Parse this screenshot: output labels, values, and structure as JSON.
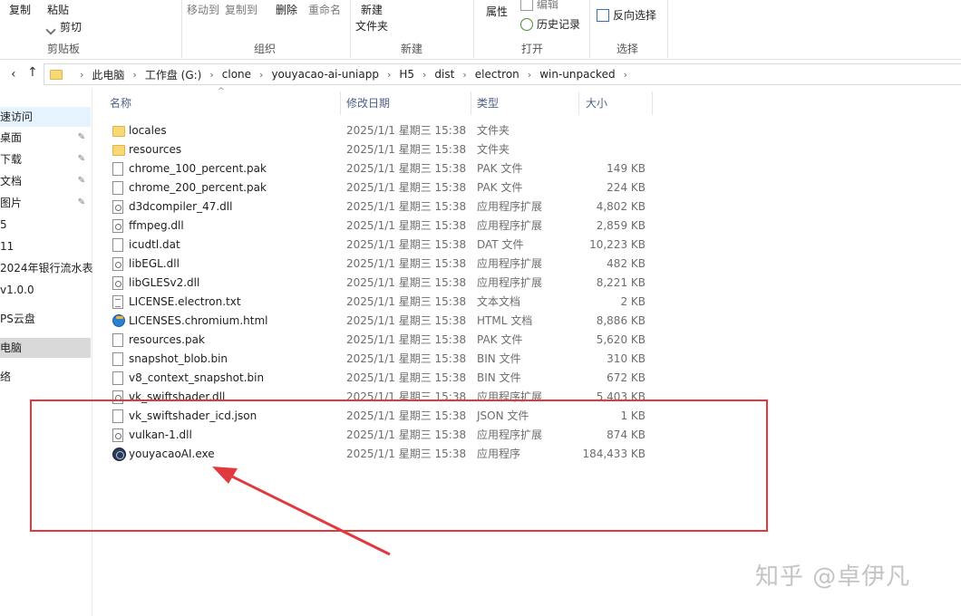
{
  "ribbon": {
    "copy": "复制",
    "paste": "粘贴",
    "cut": "剪切",
    "move_to": "移动到",
    "copy_to": "复制到",
    "delete": "删除",
    "rename": "重命名",
    "new_folder_line1": "新建",
    "new_folder_line2": "文件夹",
    "properties": "属性",
    "edit": "编辑",
    "history": "历史记录",
    "invert_selection": "反向选择",
    "groups": {
      "clipboard": "剪贴板",
      "organize": "组织",
      "new": "新建",
      "open": "打开",
      "select": "选择"
    }
  },
  "address": {
    "crumbs": [
      "此电脑",
      "工作盘 (G:)",
      "clone",
      "youyacao-ai-uniapp",
      "H5",
      "dist",
      "electron",
      "win-unpacked"
    ]
  },
  "sidebar": {
    "items": [
      {
        "label": "速访问"
      },
      {
        "label": "桌面"
      },
      {
        "label": "下载"
      },
      {
        "label": "文档"
      },
      {
        "label": "图片"
      },
      {
        "label": "5"
      },
      {
        "label": "11"
      },
      {
        "label": "2024年银行流水表"
      },
      {
        "label": "v1.0.0"
      },
      {
        "label": "PS云盘"
      },
      {
        "label": "电脑"
      },
      {
        "label": "络"
      }
    ]
  },
  "columns": {
    "name": "名称",
    "date": "修改日期",
    "type": "类型",
    "size": "大小"
  },
  "files": [
    {
      "name": "locales",
      "date": "2025/1/1 星期三 15:38",
      "type": "文件夹",
      "size": "",
      "icon": "folder-icon"
    },
    {
      "name": "resources",
      "date": "2025/1/1 星期三 15:38",
      "type": "文件夹",
      "size": "",
      "icon": "folder-icon"
    },
    {
      "name": "chrome_100_percent.pak",
      "date": "2025/1/1 星期三 15:38",
      "type": "PAK 文件",
      "size": "149 KB",
      "icon": "file-icon"
    },
    {
      "name": "chrome_200_percent.pak",
      "date": "2025/1/1 星期三 15:38",
      "type": "PAK 文件",
      "size": "224 KB",
      "icon": "file-icon"
    },
    {
      "name": "d3dcompiler_47.dll",
      "date": "2025/1/1 星期三 15:38",
      "type": "应用程序扩展",
      "size": "4,802 KB",
      "icon": "dll-icon"
    },
    {
      "name": "ffmpeg.dll",
      "date": "2025/1/1 星期三 15:38",
      "type": "应用程序扩展",
      "size": "2,859 KB",
      "icon": "dll-icon"
    },
    {
      "name": "icudtl.dat",
      "date": "2025/1/1 星期三 15:38",
      "type": "DAT 文件",
      "size": "10,223 KB",
      "icon": "file-icon"
    },
    {
      "name": "libEGL.dll",
      "date": "2025/1/1 星期三 15:38",
      "type": "应用程序扩展",
      "size": "482 KB",
      "icon": "dll-icon"
    },
    {
      "name": "libGLESv2.dll",
      "date": "2025/1/1 星期三 15:38",
      "type": "应用程序扩展",
      "size": "8,221 KB",
      "icon": "dll-icon"
    },
    {
      "name": "LICENSE.electron.txt",
      "date": "2025/1/1 星期三 15:38",
      "type": "文本文档",
      "size": "2 KB",
      "icon": "text-file-icon"
    },
    {
      "name": "LICENSES.chromium.html",
      "date": "2025/1/1 星期三 15:38",
      "type": "HTML 文档",
      "size": "8,886 KB",
      "icon": "html-file-icon"
    },
    {
      "name": "resources.pak",
      "date": "2025/1/1 星期三 15:38",
      "type": "PAK 文件",
      "size": "5,620 KB",
      "icon": "file-icon"
    },
    {
      "name": "snapshot_blob.bin",
      "date": "2025/1/1 星期三 15:38",
      "type": "BIN 文件",
      "size": "310 KB",
      "icon": "file-icon"
    },
    {
      "name": "v8_context_snapshot.bin",
      "date": "2025/1/1 星期三 15:38",
      "type": "BIN 文件",
      "size": "672 KB",
      "icon": "file-icon"
    },
    {
      "name": "vk_swiftshader.dll",
      "date": "2025/1/1 星期三 15:38",
      "type": "应用程序扩展",
      "size": "5,403 KB",
      "icon": "dll-icon"
    },
    {
      "name": "vk_swiftshader_icd.json",
      "date": "2025/1/1 星期三 15:38",
      "type": "JSON 文件",
      "size": "1 KB",
      "icon": "file-icon"
    },
    {
      "name": "vulkan-1.dll",
      "date": "2025/1/1 星期三 15:38",
      "type": "应用程序扩展",
      "size": "874 KB",
      "icon": "dll-icon"
    },
    {
      "name": "youyacaoAI.exe",
      "date": "2025/1/1 星期三 15:38",
      "type": "应用程序",
      "size": "184,433 KB",
      "icon": "app-icon"
    }
  ],
  "watermark": "知乎 @卓伊凡",
  "colors": {
    "annotation": "#e0393e",
    "folder": "#f8d775",
    "selection": "#e5f3ff"
  }
}
